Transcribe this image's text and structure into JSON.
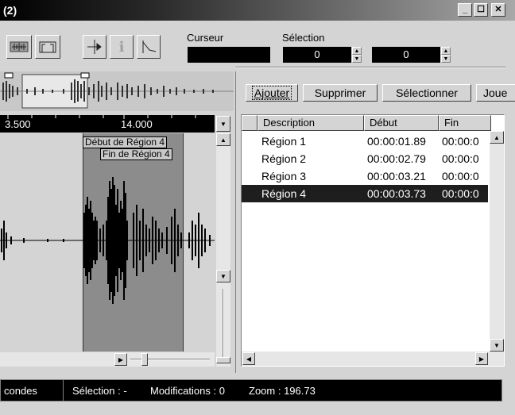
{
  "window": {
    "title": "(2)",
    "controls": {
      "minimize": "_",
      "maximize": "☐",
      "close": "✕"
    }
  },
  "toolbar": {
    "curseur_label": "Curseur",
    "curseur_value": "",
    "selection_label": "Sélection",
    "selection_start": "0",
    "selection_end": "0"
  },
  "ruler": {
    "ticks": [
      "3.500",
      "14.000"
    ]
  },
  "waveform": {
    "region_start_label": "Début de Région 4",
    "region_end_label": "Fin de Région 4"
  },
  "regions_panel": {
    "buttons": {
      "add": "Ajouter",
      "delete": "Supprimer",
      "select": "Sélectionner",
      "play": "Joue"
    },
    "columns": [
      "Description",
      "Début",
      "Fin"
    ],
    "rows": [
      {
        "description": "Région 1",
        "start": "00:00:01.89",
        "end": "00:00:0"
      },
      {
        "description": "Région 2",
        "start": "00:00:02.79",
        "end": "00:00:0"
      },
      {
        "description": "Région 3",
        "start": "00:00:03.21",
        "end": "00:00:0"
      },
      {
        "description": "Région 4",
        "start": "00:00:03.73",
        "end": "00:00:0",
        "selected": true
      }
    ]
  },
  "status": {
    "units": "condes",
    "selection": "Sélection : -",
    "modifications": "Modifications : 0",
    "zoom": "Zoom : 196.73"
  }
}
